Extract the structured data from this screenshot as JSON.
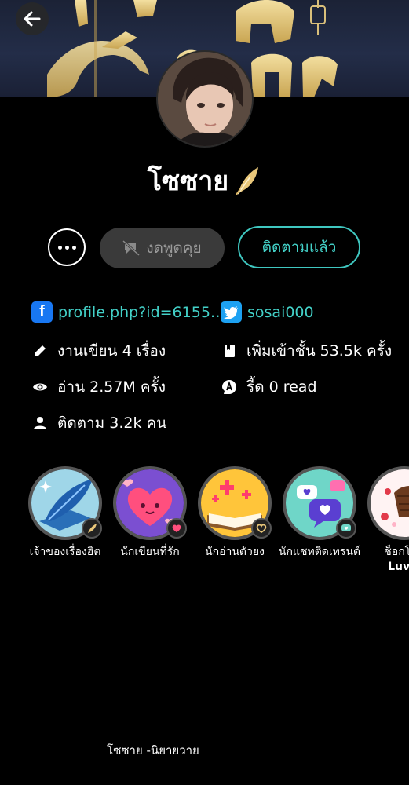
{
  "profile": {
    "name": "โซซาย",
    "chat_label": "งดพูดคุย",
    "follow_label": "ติดตามแล้ว"
  },
  "social": {
    "facebook": "profile.php?id=6155…",
    "twitter": "sosai000"
  },
  "stats": {
    "works": "งานเขียน 4 เรื่อง",
    "library": "เพิ่มเข้าชั้น 53.5k ครั้ง",
    "views": "อ่าน 2.57M ครั้ง",
    "reads": "รี้ด 0 read",
    "followers": "ติดตาม 3.2k คน"
  },
  "badges": [
    {
      "label": "เจ้าของเรื่องฮิต",
      "icon": "quill-badge-icon"
    },
    {
      "label": "นักเขียนที่รัก",
      "icon": "heart-badge-icon"
    },
    {
      "label": "นักอ่านตัวยง",
      "icon": "book-badge-icon"
    },
    {
      "label": "นักแชทติดเทรนด์",
      "icon": "chat-badge-icon"
    },
    {
      "label": "ช็อกโกแ",
      "sublabel": "Luv L",
      "icon": "chocolate-badge-icon"
    }
  ],
  "footer": {
    "text": "โซซาย -นิยายวาย"
  },
  "colors": {
    "accent": "#43d1c8",
    "facebook": "#1877f2",
    "twitter": "#1da1f2",
    "background": "#000000"
  }
}
